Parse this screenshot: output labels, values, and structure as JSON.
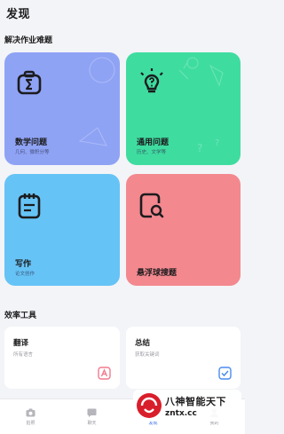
{
  "header": {
    "title": "发现"
  },
  "section_solve": {
    "title": "解决作业难题"
  },
  "solve_cards": [
    {
      "title": "数学问题",
      "subtitle": "几何、微积分等",
      "color": "#8fa3f5",
      "icon": "sigma-camera-icon"
    },
    {
      "title": "通用问题",
      "subtitle": "历史、文学等",
      "color": "#3fdca0",
      "icon": "lightbulb-question-icon"
    },
    {
      "title": "写作",
      "subtitle": "论文创作",
      "color": "#66c3f6",
      "icon": "notepad-icon"
    },
    {
      "title": "悬浮球搜题",
      "subtitle": "",
      "color": "#f3888f",
      "icon": "search-document-icon"
    }
  ],
  "section_tools": {
    "title": "效率工具"
  },
  "tool_cards": [
    {
      "title": "翻译",
      "subtitle": "所有语言",
      "icon": "translate-icon",
      "accent": "#f07b8e"
    },
    {
      "title": "总结",
      "subtitle": "获取关键词",
      "icon": "checklist-icon",
      "accent": "#4a8bef"
    }
  ],
  "tabbar": {
    "active_color": "#2d63e8",
    "tabs": [
      {
        "label": "拍照",
        "icon": "camera-icon",
        "active": false
      },
      {
        "label": "聊天",
        "icon": "chat-icon",
        "active": false
      },
      {
        "label": "发现",
        "icon": "discover-icon",
        "active": true
      },
      {
        "label": "我的",
        "icon": "profile-icon",
        "active": false
      }
    ]
  },
  "watermark": {
    "title": "八神智能天下",
    "url": "zntx.cc"
  }
}
